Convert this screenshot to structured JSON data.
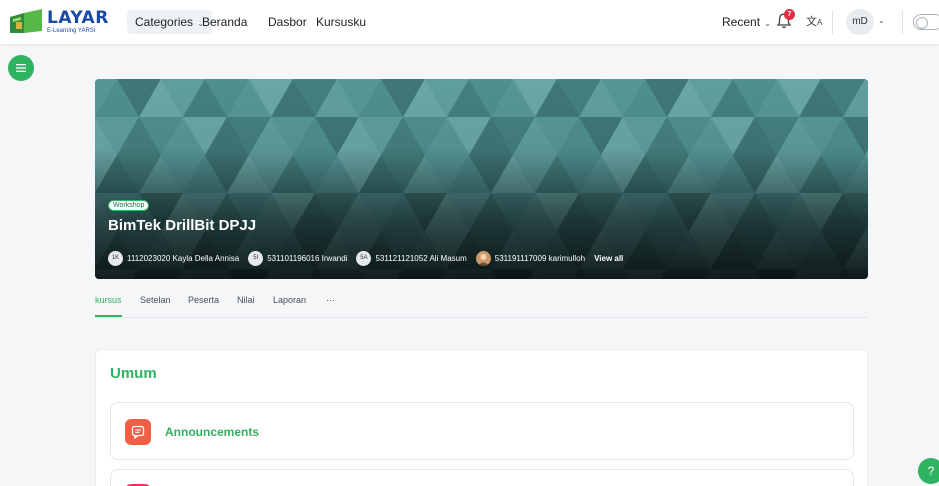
{
  "logo": {
    "title": "LAYAR",
    "subtitle": "E-Learning YARSI"
  },
  "navbar": {
    "categories_label": "Categories",
    "links": [
      "Beranda",
      "Dasbor",
      "Kursusku"
    ],
    "recent_label": "Recent",
    "notification_count": "7",
    "user_initials": "mD"
  },
  "hero": {
    "badge": "Workshop",
    "title": "BimTek DrillBit DPJJ",
    "participants": [
      {
        "initials": "1K",
        "name": "1112023020 Kayla Della Annisa"
      },
      {
        "initials": "5I",
        "name": "531101196016 Irwandi"
      },
      {
        "initials": "5A",
        "name": "531121121052 Ali Masum"
      },
      {
        "initials": "",
        "name": "531191117009 karimulloh"
      }
    ],
    "view_all": "View all"
  },
  "tabs": [
    "kursus",
    "Setelan",
    "Peserta",
    "Nilai",
    "Laporan",
    "···"
  ],
  "section": {
    "title": "Umum",
    "activities": [
      {
        "name": "Announcements"
      }
    ]
  },
  "colors": {
    "accent": "#2fb361",
    "announcement_icon": "#f05f44",
    "hero_teal": "#4e8f90"
  }
}
